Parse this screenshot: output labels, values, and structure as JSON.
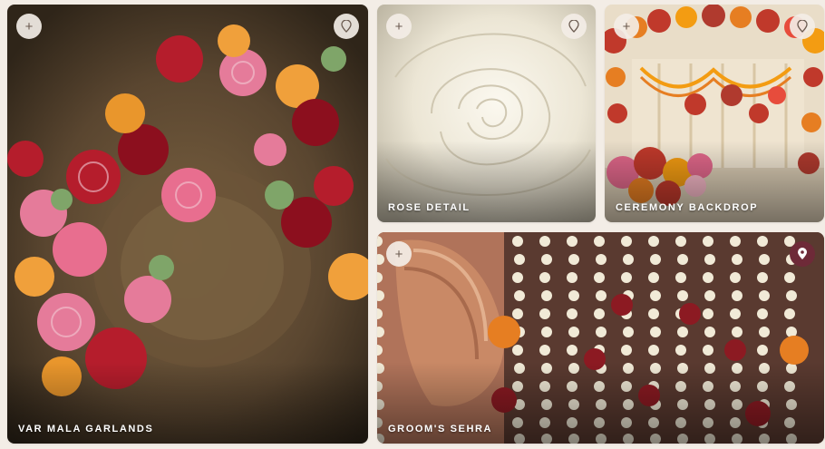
{
  "tiles": [
    {
      "caption": "VAR MALA GARLANDS",
      "add_glyph": "+",
      "pin_icon": "map-pin-outline-icon",
      "pinned": false
    },
    {
      "caption": "ROSE DETAIL",
      "add_glyph": "+",
      "pin_icon": "map-pin-outline-icon",
      "pinned": false
    },
    {
      "caption": "CEREMONY BACKDROP",
      "add_glyph": "+",
      "pin_icon": "map-pin-outline-icon",
      "pinned": false
    },
    {
      "caption": "GROOM'S SEHRA",
      "add_glyph": "+",
      "pin_icon": "map-pin-filled-icon",
      "pinned": true
    }
  ],
  "colors": {
    "background": "#f3ede6",
    "pin_active": "#6e2a38",
    "button_bg": "#f3ede6",
    "caption_text": "#ffffff"
  }
}
